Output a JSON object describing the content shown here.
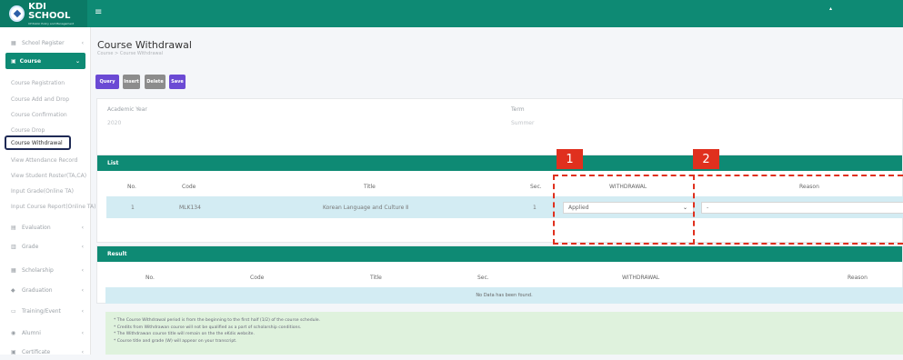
{
  "header": {
    "logo_text": "KDI SCHOOL",
    "logo_sub": "Of Public Policy and Management",
    "menu_icon": "hamburger-icon",
    "user_caret": "▴"
  },
  "sidebar": {
    "school_register": "School Register",
    "course": "Course",
    "sub_items": [
      "Course Registration",
      "Course Add and Drop",
      "Course Confirmation",
      "Course Drop",
      "Course Withdrawal",
      "View Attendance Record",
      "View Student Roster(TA,CA)",
      "Input Grade(Online TA)",
      "Input Course Report(Online TA)"
    ],
    "items": [
      {
        "label": "Evaluation",
        "icon": "evaluation-icon"
      },
      {
        "label": "Grade",
        "icon": "grade-icon"
      },
      {
        "label": "Scholarship",
        "icon": "scholarship-icon"
      },
      {
        "label": "Graduation",
        "icon": "graduation-icon"
      },
      {
        "label": "Training/Event",
        "icon": "training-icon"
      },
      {
        "label": "Alumni",
        "icon": "alumni-icon"
      },
      {
        "label": "Certificate",
        "icon": "certificate-icon"
      }
    ]
  },
  "page": {
    "title": "Course Withdrawal",
    "breadcrumb": "Course  >  Course Withdrawal"
  },
  "toolbar": {
    "query": "Query",
    "insert": "Insert",
    "delete": "Delete",
    "save": "Save"
  },
  "filter": {
    "academic_year_label": "Academic Year",
    "academic_year_value": "2020",
    "term_label": "Term",
    "term_value": "Summer"
  },
  "list": {
    "title": "List",
    "columns": [
      "No.",
      "Code",
      "Title",
      "Sec.",
      "WITHDRAWAL",
      "Reason"
    ],
    "rows": [
      {
        "no": "1",
        "code": "MLK134",
        "title": "Korean Language and Culture Ⅱ",
        "sec": "1",
        "withdrawal": "Applied",
        "reason": "-"
      }
    ]
  },
  "markers": {
    "one": "1",
    "two": "2"
  },
  "result": {
    "title": "Result",
    "columns": [
      "No.",
      "Code",
      "Title",
      "Sec.",
      "WITHDRAWAL",
      "Reason"
    ],
    "empty": "No Data has been found."
  },
  "notes": [
    "* The Course Withdrawal period is from the beginning to the first half (1/2) of the course schedule.",
    "* Credits from Withdrawan course will not be qualified as a part of scholarship conditions.",
    "* The Withdrawan course title will remain on the the eKdis website.",
    "* Course title and grade (W) will appear on your transcript."
  ],
  "colors": {
    "brand": "#0e8a74",
    "primary_button": "#6b4ad4",
    "annotation": "#e0301e"
  }
}
